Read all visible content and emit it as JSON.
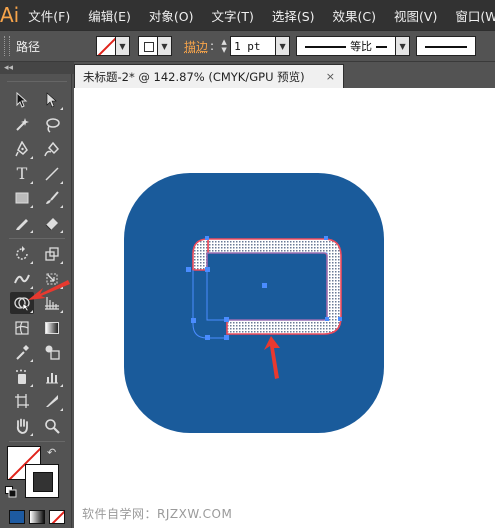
{
  "app": {
    "logo": "Ai"
  },
  "menu": [
    "文件(F)",
    "编辑(E)",
    "对象(O)",
    "文字(T)",
    "选择(S)",
    "效果(C)",
    "视图(V)",
    "窗口(W)"
  ],
  "control_bar": {
    "selection_label": "路径",
    "stroke_label": "描边",
    "colon": ":",
    "stroke_weight": "1 pt",
    "profile_label": "等比"
  },
  "toolbar": {
    "collapse_label": "◂◂",
    "tools": [
      [
        "selection-tool",
        "direct-selection-tool"
      ],
      [
        "magic-wand-tool",
        "lasso-tool"
      ],
      [
        "pen-tool",
        "curvature-tool"
      ],
      [
        "type-tool",
        "line-segment-tool"
      ],
      [
        "rectangle-tool",
        "paintbrush-tool"
      ],
      [
        "pencil-tool",
        "eraser-tool"
      ],
      [
        "rotate-tool",
        "scale-tool"
      ],
      [
        "width-tool",
        "free-transform-tool"
      ],
      [
        "shape-builder-tool",
        "perspective-grid-tool"
      ],
      [
        "mesh-tool",
        "gradient-tool"
      ],
      [
        "eyedropper-tool",
        "blend-tool"
      ],
      [
        "symbol-sprayer-tool",
        "column-graph-tool"
      ],
      [
        "artboard-tool",
        "slice-tool"
      ],
      [
        "hand-tool",
        "zoom-tool"
      ]
    ],
    "active_tool": "shape-builder-tool"
  },
  "document": {
    "tab_title": "未标题-2* @ 142.87% (CMYK/GPU 预览)",
    "close_glyph": "×"
  },
  "canvas": {
    "icon_color": "#1a5b9b",
    "selection_color": "#ee4b5c",
    "handle_color": "#4a8cff",
    "annotation_color": "#e8392f"
  },
  "watermark": "软件自学网：RJZXW.COM"
}
